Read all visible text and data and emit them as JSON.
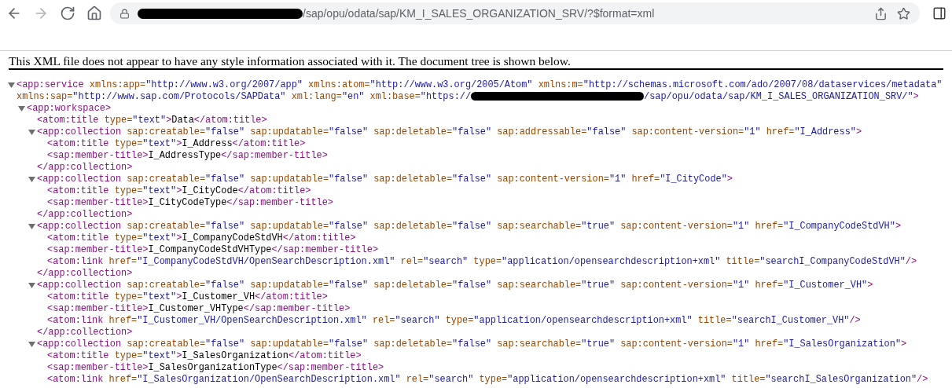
{
  "toolbar": {
    "back": {
      "disabled": false
    },
    "forward": {
      "disabled": true
    },
    "address": {
      "redacted": true,
      "url": "/sap/opu/odata/sap/KM_I_SALES_ORGANIZATION_SRV/?$format=xml"
    }
  },
  "banner": "This XML file does not appear to have any style information associated with it. The document tree is shown below.",
  "tree": [
    {
      "tag": "<app:service",
      "expanded": true,
      "attrs": [
        {
          "name": "xmlns:app=",
          "value": "\"http://www.w3.org/2007/app\""
        },
        {
          "name": "xmlns:atom=",
          "value": "\"http://www.w3.org/2005/Atom\""
        },
        {
          "name": "xmlns:m=",
          "value": "\"http://schemas.microsoft.com/ado/2007/08/dataservices/metadata\""
        }
      ],
      "attrs_continued": [
        {
          "name": "xmlns:sap=",
          "value": "\"http://www.sap.com/Protocols/SAPData\""
        },
        {
          "name": "xml:lang=",
          "value": "\"en\""
        },
        {
          "name": "xml:base=",
          "value": "\"https://",
          "redacted": true,
          "value_end": "/sap/opu/odata/sap/KM_I_SALES_ORGANIZATION_SRV/\""
        }
      ],
      "end": ">",
      "children": [
        {
          "tag": "<app:workspace",
          "expanded": true,
          "end": ">",
          "children": [
            {
              "tag": "<atom:title",
              "attrs": [
                {
                  "name": "type=",
                  "value": "\"text\""
                }
              ],
              "end": ">",
              "text": "Data",
              "close": "</atom:title>"
            },
            {
              "tag": "<app:collection",
              "expanded": true,
              "attrs": [
                {
                  "name": "sap:creatable=",
                  "value": "\"false\""
                },
                {
                  "name": "sap:updatable=",
                  "value": "\"false\""
                },
                {
                  "name": "sap:deletable=",
                  "value": "\"false\""
                },
                {
                  "name": "sap:addressable=",
                  "value": "\"false\""
                },
                {
                  "name": "sap:content-version=",
                  "value": "\"1\""
                },
                {
                  "name": "href=",
                  "value": "\"I_Address\""
                }
              ],
              "end": ">",
              "children": [
                {
                  "tag": "<atom:title",
                  "attrs": [
                    {
                      "name": "type=",
                      "value": "\"text\""
                    }
                  ],
                  "end": ">",
                  "text": "I_Address",
                  "close": "</atom:title>"
                },
                {
                  "tag": "<sap:member-title",
                  "end": ">",
                  "text": "I_AddressType",
                  "close": "</sap:member-title>"
                }
              ],
              "close": "</app:collection>"
            },
            {
              "tag": "<app:collection",
              "expanded": true,
              "attrs": [
                {
                  "name": "sap:creatable=",
                  "value": "\"false\""
                },
                {
                  "name": "sap:updatable=",
                  "value": "\"false\""
                },
                {
                  "name": "sap:deletable=",
                  "value": "\"false\""
                },
                {
                  "name": "sap:content-version=",
                  "value": "\"1\""
                },
                {
                  "name": "href=",
                  "value": "\"I_CityCode\""
                }
              ],
              "end": ">",
              "children": [
                {
                  "tag": "<atom:title",
                  "attrs": [
                    {
                      "name": "type=",
                      "value": "\"text\""
                    }
                  ],
                  "end": ">",
                  "text": "I_CityCode",
                  "close": "</atom:title>"
                },
                {
                  "tag": "<sap:member-title",
                  "end": ">",
                  "text": "I_CityCodeType",
                  "close": "</sap:member-title>"
                }
              ],
              "close": "</app:collection>"
            },
            {
              "tag": "<app:collection",
              "expanded": true,
              "attrs": [
                {
                  "name": "sap:creatable=",
                  "value": "\"false\""
                },
                {
                  "name": "sap:updatable=",
                  "value": "\"false\""
                },
                {
                  "name": "sap:deletable=",
                  "value": "\"false\""
                },
                {
                  "name": "sap:searchable=",
                  "value": "\"true\""
                },
                {
                  "name": "sap:content-version=",
                  "value": "\"1\""
                },
                {
                  "name": "href=",
                  "value": "\"I_CompanyCodeStdVH\""
                }
              ],
              "end": ">",
              "children": [
                {
                  "tag": "<atom:title",
                  "attrs": [
                    {
                      "name": "type=",
                      "value": "\"text\""
                    }
                  ],
                  "end": ">",
                  "text": "I_CompanyCodeStdVH",
                  "close": "</atom:title>"
                },
                {
                  "tag": "<sap:member-title",
                  "end": ">",
                  "text": "I_CompanyCodeStdVHType",
                  "close": "</sap:member-title>"
                },
                {
                  "tag": "<atom:link",
                  "attrs": [
                    {
                      "name": "href=",
                      "value": "\"I_CompanyCodeStdVH/OpenSearchDescription.xml\""
                    },
                    {
                      "name": "rel=",
                      "value": "\"search\""
                    },
                    {
                      "name": "type=",
                      "value": "\"application/opensearchdescription+xml\""
                    },
                    {
                      "name": "title=",
                      "value": "\"searchI_CompanyCodeStdVH\""
                    }
                  ],
                  "end": "/>"
                }
              ],
              "close": "</app:collection>"
            },
            {
              "tag": "<app:collection",
              "expanded": true,
              "attrs": [
                {
                  "name": "sap:creatable=",
                  "value": "\"false\""
                },
                {
                  "name": "sap:updatable=",
                  "value": "\"false\""
                },
                {
                  "name": "sap:deletable=",
                  "value": "\"false\""
                },
                {
                  "name": "sap:searchable=",
                  "value": "\"true\""
                },
                {
                  "name": "sap:content-version=",
                  "value": "\"1\""
                },
                {
                  "name": "href=",
                  "value": "\"I_Customer_VH\""
                }
              ],
              "end": ">",
              "children": [
                {
                  "tag": "<atom:title",
                  "attrs": [
                    {
                      "name": "type=",
                      "value": "\"text\""
                    }
                  ],
                  "end": ">",
                  "text": "I_Customer_VH",
                  "close": "</atom:title>"
                },
                {
                  "tag": "<sap:member-title",
                  "end": ">",
                  "text": "I_Customer_VHType",
                  "close": "</sap:member-title>"
                },
                {
                  "tag": "<atom:link",
                  "attrs": [
                    {
                      "name": "href=",
                      "value": "\"I_Customer_VH/OpenSearchDescription.xml\""
                    },
                    {
                      "name": "rel=",
                      "value": "\"search\""
                    },
                    {
                      "name": "type=",
                      "value": "\"application/opensearchdescription+xml\""
                    },
                    {
                      "name": "title=",
                      "value": "\"searchI_Customer_VH\""
                    }
                  ],
                  "end": "/>"
                }
              ],
              "close": "</app:collection>"
            },
            {
              "tag": "<app:collection",
              "expanded": true,
              "attrs": [
                {
                  "name": "sap:creatable=",
                  "value": "\"false\""
                },
                {
                  "name": "sap:updatable=",
                  "value": "\"false\""
                },
                {
                  "name": "sap:deletable=",
                  "value": "\"false\""
                },
                {
                  "name": "sap:searchable=",
                  "value": "\"true\""
                },
                {
                  "name": "sap:content-version=",
                  "value": "\"1\""
                },
                {
                  "name": "href=",
                  "value": "\"I_SalesOrganization\""
                }
              ],
              "end": ">",
              "children": [
                {
                  "tag": "<atom:title",
                  "attrs": [
                    {
                      "name": "type=",
                      "value": "\"text\""
                    }
                  ],
                  "end": ">",
                  "text": "I_SalesOrganization",
                  "close": "</atom:title>"
                },
                {
                  "tag": "<sap:member-title",
                  "end": ">",
                  "text": "I_SalesOrganizationType",
                  "close": "</sap:member-title>"
                },
                {
                  "tag": "<atom:link",
                  "attrs": [
                    {
                      "name": "href=",
                      "value": "\"I_SalesOrganization/OpenSearchDescription.xml\""
                    },
                    {
                      "name": "rel=",
                      "value": "\"search\""
                    },
                    {
                      "name": "type=",
                      "value": "\"application/opensearchdescription+xml\""
                    },
                    {
                      "name": "title=",
                      "value": "\"searchI_SalesOrganization\""
                    }
                  ],
                  "end": "/>"
                }
              ]
            }
          ]
        }
      ]
    }
  ]
}
